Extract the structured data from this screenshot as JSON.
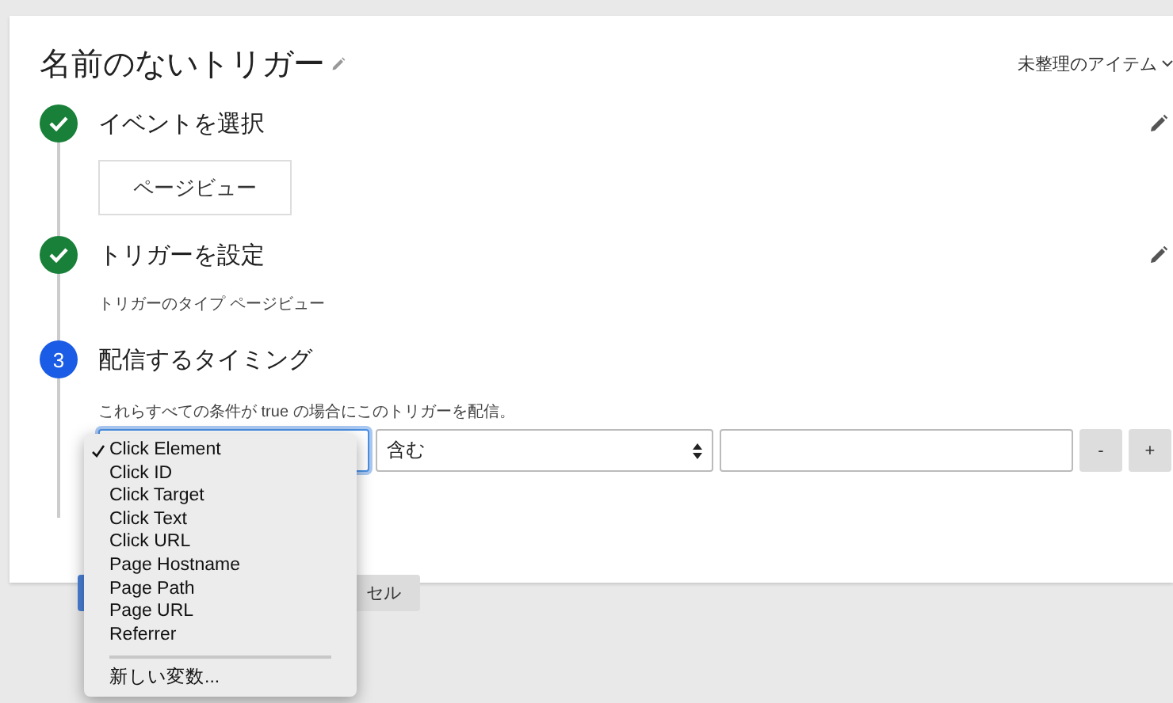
{
  "title": "名前のないトリガー",
  "folder": {
    "label": "未整理のアイテム"
  },
  "steps": [
    {
      "kind": "done",
      "title": "イベントを選択",
      "editable": true,
      "chip": "ページビュー"
    },
    {
      "kind": "done",
      "title": "トリガーを設定",
      "editable": true,
      "detail": "トリガーのタイプ ページビュー"
    },
    {
      "kind": "current",
      "number": "3",
      "title": "配信するタイミング",
      "editable": false,
      "detail": "これらすべての条件が true の場合にこのトリガーを配信。"
    }
  ],
  "condition": {
    "variable": {
      "focused": true,
      "open": true
    },
    "operator": "含む",
    "buttons": [
      "-",
      "+"
    ]
  },
  "menu": {
    "options": [
      {
        "label": "Click Element",
        "selected": true
      },
      {
        "label": "Click ID",
        "selected": false
      },
      {
        "label": "Click Target",
        "selected": false
      },
      {
        "label": "Click Text",
        "selected": false
      },
      {
        "label": "Click URL",
        "selected": false
      },
      {
        "label": "Page Hostname",
        "selected": false
      },
      {
        "label": "Page Path",
        "selected": false
      },
      {
        "label": "Page URL",
        "selected": false
      },
      {
        "label": "Referrer",
        "selected": false
      }
    ],
    "extra": "新しい変数..."
  },
  "actions": [
    {
      "kind": "primary"
    },
    {
      "kind": "secondary",
      "label": "セル"
    }
  ]
}
